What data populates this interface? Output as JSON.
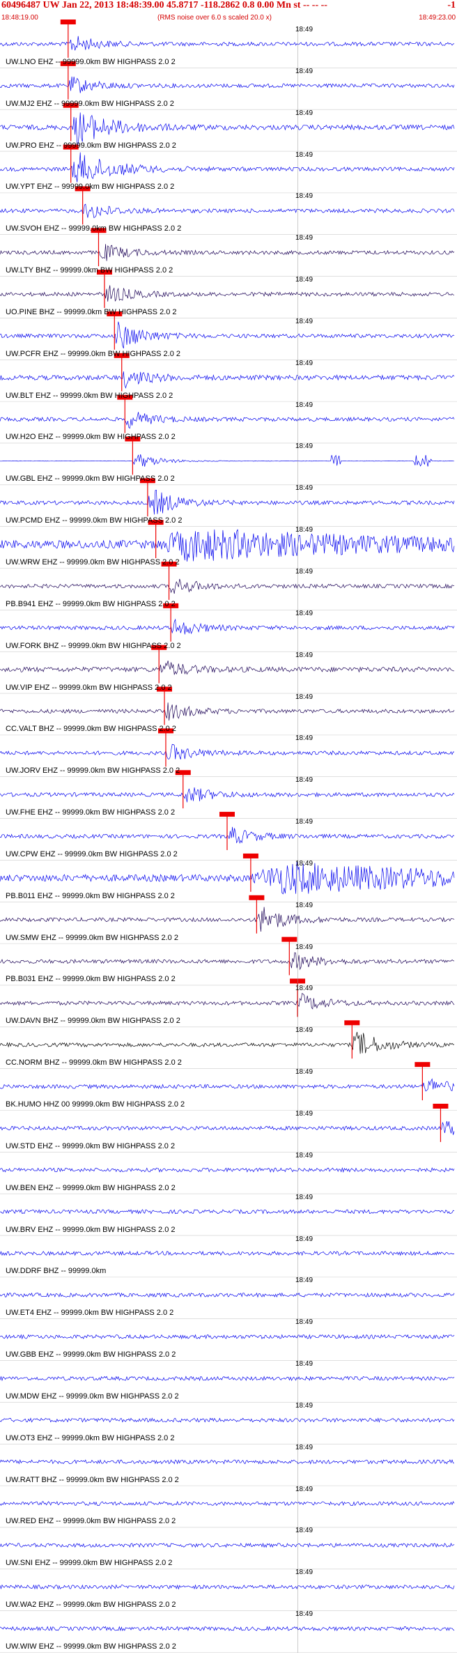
{
  "header": {
    "title": "60496487 UW Jan 22, 2013 18:48:39.00   45.8717 -118.2862  0.8 0.00 Mn st -- -- --",
    "title_right": "-1",
    "subtitle": "(RMS noise over 6.0 s scaled 20.0 x)",
    "time_start": "18:48:19.00",
    "time_end": "18:49:23.00"
  },
  "colors": {
    "trace_blue": "#0000ee",
    "trace_dark": "#1a0055",
    "trace_black": "#000000",
    "pick_red": "#ee0000",
    "header_red": "#d40000"
  },
  "chart_data": {
    "type": "line",
    "title": "60496487 UW Jan 22, 2013 18:48:39.00   45.8717 -118.2862  0.8 0.00 Mn st -- -- --",
    "subtitle": "(RMS noise over 6.0 s scaled 20.0 x)",
    "x_range": [
      "18:48:19.00",
      "18:49:23.00"
    ],
    "time_tick_label": "18:49",
    "traces": [
      {
        "label": "UW.LNO EHZ -- 99999.0km BW  HIGHPASS  2.0  2",
        "pick": 0.15
      },
      {
        "label": "UW.MJ2 EHZ -- 99999.0km BW  HIGHPASS  2.0  2",
        "pick": 0.15
      },
      {
        "label": "UW.PRO EHZ -- 99999.0km BW  HIGHPASS  2.0  2",
        "pick": 0.156
      },
      {
        "label": "UW.YPT EHZ -- 99999.0km BW  HIGHPASS  2.0  2",
        "pick": 0.156
      },
      {
        "label": "UW.SVOH EHZ -- 99999.0km BW  HIGHPASS  2.0  2",
        "pick": 0.182
      },
      {
        "label": "UW.LTY BHZ -- 99999.0km BW  HIGHPASS  2.0  2",
        "pick": 0.217
      },
      {
        "label": "UO.PINE BHZ -- 99999.0km BW  HIGHPASS  2.0  2",
        "pick": 0.23
      },
      {
        "label": "UW.PCFR EHZ -- 99999.0km BW  HIGHPASS  2.0  2",
        "pick": 0.252
      },
      {
        "label": "UW.BLT EHZ -- 99999.0km BW  HIGHPASS  2.0  2",
        "pick": 0.268
      },
      {
        "label": "UW.H2O EHZ -- 99999.0km BW  HIGHPASS  2.0  2",
        "pick": 0.275
      },
      {
        "label": "UW.GBL EHZ -- 99999.0km BW  HIGHPASS  2.0  2",
        "pick": 0.292
      },
      {
        "label": "UW.PCMD EHZ -- 99999.0km BW  HIGHPASS  2.0  2",
        "pick": 0.325
      },
      {
        "label": "UW.WRW EHZ -- 99999.0km BW  HIGHPASS  2.0  2",
        "pick": 0.343
      },
      {
        "label": "PB.B941 EHZ -- 99999.0km BW  HIGHPASS  2.0  2",
        "pick": 0.372
      },
      {
        "label": "UW.FORK BHZ -- 99999.0km BW  HIGHPASS  2.0  2",
        "pick": 0.376
      },
      {
        "label": "UW.VIP EHZ -- 99999.0km BW  HIGHPASS  2.0  2",
        "pick": 0.35
      },
      {
        "label": "CC.VALT BHZ -- 99999.0km BW  HIGHPASS  2.0  2",
        "pick": 0.362
      },
      {
        "label": "UW.JORV EHZ -- 99999.0km BW  HIGHPASS  2.0  2",
        "pick": 0.365
      },
      {
        "label": "UW.FHE EHZ -- 99999.0km BW  HIGHPASS  2.0  2",
        "pick": 0.403
      },
      {
        "label": "UW.CPW EHZ -- 99999.0km BW  HIGHPASS  2.0  2",
        "pick": 0.5
      },
      {
        "label": "PB.B011 EHZ -- 99999.0km BW  HIGHPASS  2.0  2",
        "pick": 0.552
      },
      {
        "label": "UW.SMW EHZ -- 99999.0km BW  HIGHPASS  2.0  2",
        "pick": 0.565
      },
      {
        "label": "PB.B031 EHZ -- 99999.0km BW  HIGHPASS  2.0  2",
        "pick": 0.637
      },
      {
        "label": "UW.DAVN BHZ -- 99999.0km BW  HIGHPASS  2.0  2",
        "pick": 0.655
      },
      {
        "label": "CC.NORM BHZ -- 99999.0km BW  HIGHPASS  2.0  2",
        "pick": 0.775
      },
      {
        "label": "BK.HUMO HHZ 00 99999.0km BW  HIGHPASS  2.0  2",
        "pick": 0.93
      },
      {
        "label": "UW.STD EHZ -- 99999.0km BW  HIGHPASS  2.0  2",
        "pick": 0.97
      },
      {
        "label": "UW.BEN EHZ -- 99999.0km BW  HIGHPASS  2.0  2",
        "pick": null
      },
      {
        "label": "UW.BRV EHZ -- 99999.0km BW  HIGHPASS  2.0  2",
        "pick": null
      },
      {
        "label": "UW.DDRF BHZ -- 99999.0km",
        "pick": null
      },
      {
        "label": "UW.ET4 EHZ -- 99999.0km BW  HIGHPASS  2.0  2",
        "pick": null
      },
      {
        "label": "UW.GBB EHZ -- 99999.0km BW  HIGHPASS  2.0  2",
        "pick": null
      },
      {
        "label": "UW.MDW EHZ -- 99999.0km BW  HIGHPASS  2.0  2",
        "pick": null
      },
      {
        "label": "UW.OT3 EHZ -- 99999.0km BW  HIGHPASS  2.0  2",
        "pick": null
      },
      {
        "label": "UW.RATT BHZ -- 99999.0km BW  HIGHPASS  2.0  2",
        "pick": null
      },
      {
        "label": "UW.RED EHZ -- 99999.0km BW  HIGHPASS  2.0  2",
        "pick": null
      },
      {
        "label": "UW.SNI EHZ -- 99999.0km BW  HIGHPASS  2.0  2",
        "pick": null
      },
      {
        "label": "UW.WA2 EHZ -- 99999.0km BW  HIGHPASS  2.0  2",
        "pick": null
      },
      {
        "label": "UW.WIW EHZ -- 99999.0km BW  HIGHPASS  2.0  2",
        "pick": null
      }
    ]
  }
}
